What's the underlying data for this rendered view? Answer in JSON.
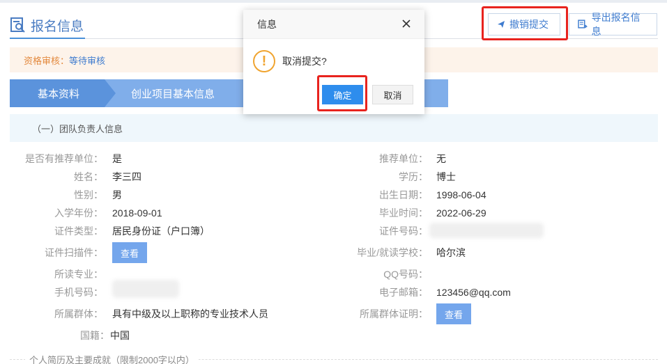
{
  "header": {
    "title": "报名信息",
    "revoke_label": "撤销提交",
    "export_label": "导出报名信息"
  },
  "status": {
    "label": "资格审核：",
    "value": "等待审核"
  },
  "steps": [
    {
      "label": "基本资料"
    },
    {
      "label": "创业项目基本信息"
    }
  ],
  "section": {
    "title": "（一）团队负责人信息",
    "bottom_title": "个人简历及主要成就（限制2000字以内）"
  },
  "info": {
    "recommend_unit_flag": {
      "label": "是否有推荐单位：",
      "value": "是"
    },
    "recommend_unit": {
      "label": "推荐单位：",
      "value": "无"
    },
    "name": {
      "label": "姓名：",
      "value": "李三四"
    },
    "education": {
      "label": "学历：",
      "value": "博士"
    },
    "gender": {
      "label": "性别：",
      "value": "男"
    },
    "birthday": {
      "label": "出生日期：",
      "value": "1998-06-04"
    },
    "enroll_year": {
      "label": "入学年份：",
      "value": "2018-09-01"
    },
    "graduate_time": {
      "label": "毕业时间：",
      "value": "2022-06-29"
    },
    "id_type": {
      "label": "证件类型：",
      "value": "居民身份证（户口簿）"
    },
    "id_number": {
      "label": "证件号码：",
      "value": ""
    },
    "id_scan": {
      "label": "证件扫描件：",
      "button": "查看"
    },
    "school": {
      "label": "毕业/就读学校：",
      "value": "哈尔滨"
    },
    "major": {
      "label": "所读专业：",
      "value": ""
    },
    "qq": {
      "label": "QQ号码：",
      "value": ""
    },
    "phone": {
      "label": "手机号码：",
      "value": ""
    },
    "email": {
      "label": "电子邮箱：",
      "value": "123456@qq.com"
    },
    "group": {
      "label": "所属群体：",
      "value": "具有中级及以上职称的专业技术人员"
    },
    "group_proof": {
      "label": "所属群体证明：",
      "button": "查看"
    },
    "nationality": {
      "label": "国籍：",
      "value": "中国"
    }
  },
  "dialog": {
    "title": "信息",
    "message": "取消提交?",
    "ok_label": "确定",
    "cancel_label": "取消"
  },
  "colors": {
    "accent": "#4a7cc2",
    "highlight_box": "#e8231e",
    "primary_button": "#2e8ded",
    "warning": "#f0a430"
  }
}
